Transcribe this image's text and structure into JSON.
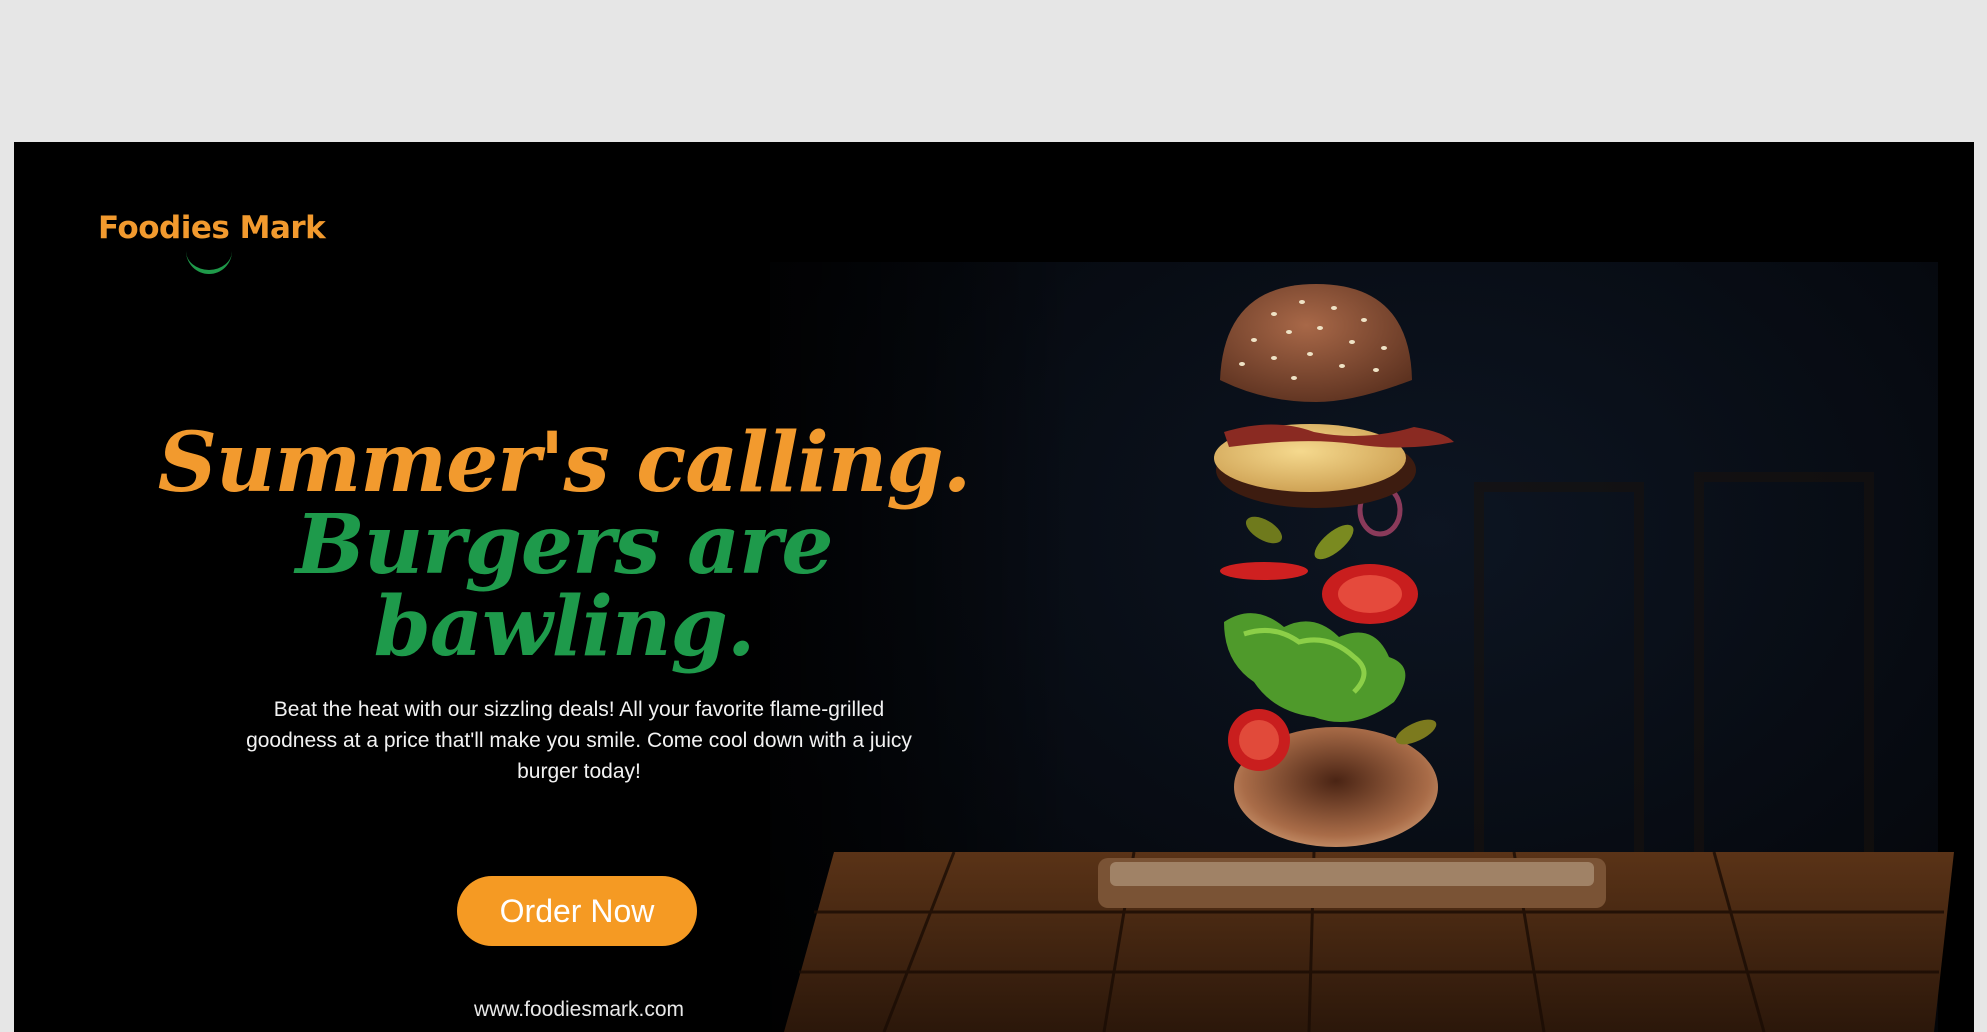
{
  "brand": {
    "logo_text": "Foodies Mark"
  },
  "headline": {
    "part1": "Summer's calling.",
    "part2": "Burgers are bawling."
  },
  "description": "Beat the heat with our sizzling deals! All your favorite flame-grilled goodness at a price that'll make you smile. Come cool down with a juicy burger today!",
  "cta": {
    "label": "Order Now"
  },
  "website": "www.foodiesmark.com",
  "colors": {
    "page_background": "#e6e6e6",
    "banner_background": "#000000",
    "accent_orange": "#f29a2e",
    "accent_green": "#1e9a4b",
    "button": "#f59a23"
  }
}
